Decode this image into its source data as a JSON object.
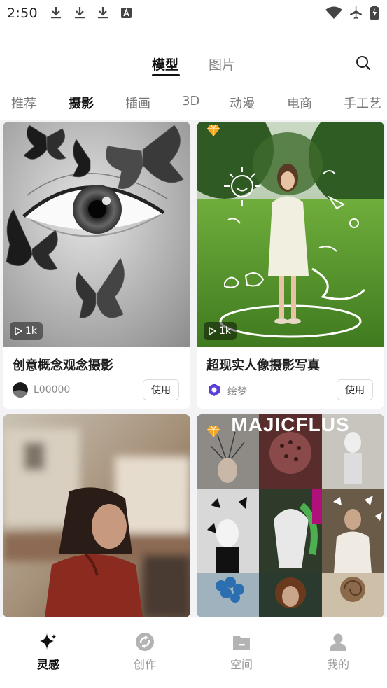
{
  "status_bar": {
    "time": "2:50",
    "left_icons": [
      "download-icon",
      "download-icon",
      "download-icon",
      "font-icon"
    ],
    "right_icons": [
      "wifi-icon",
      "airplane-icon",
      "battery-charging-icon"
    ]
  },
  "header": {
    "tabs": [
      {
        "label": "模型",
        "active": true
      },
      {
        "label": "图片",
        "active": false
      }
    ],
    "search_icon": "search-icon"
  },
  "categories": [
    "推荐",
    "摄影",
    "插画",
    "3D",
    "动漫",
    "电商",
    "手工艺"
  ],
  "active_category": "摄影",
  "cards": [
    {
      "title": "创意概念观念摄影",
      "author": "L00000",
      "plays": "1k",
      "use_label": "使用",
      "premium": false
    },
    {
      "title": "超现实人像摄影写真",
      "author": "绘梦",
      "plays": "1k",
      "use_label": "使用",
      "premium": true
    },
    {
      "premium": false
    },
    {
      "banner_text": "MAJICFLUS",
      "premium": true
    }
  ],
  "bottom_nav": [
    {
      "label": "灵感",
      "icon": "sparkle-icon",
      "active": true
    },
    {
      "label": "创作",
      "icon": "create-icon",
      "active": false
    },
    {
      "label": "空间",
      "icon": "folder-icon",
      "active": false
    },
    {
      "label": "我的",
      "icon": "user-icon",
      "active": false
    }
  ],
  "colors": {
    "background": "#f3f3f5",
    "card": "#ffffff",
    "text_primary": "#1f1f1f",
    "text_secondary": "#8a8a8a",
    "premium_badge": "#f5a623",
    "author_badge": "#5b3fd8"
  }
}
